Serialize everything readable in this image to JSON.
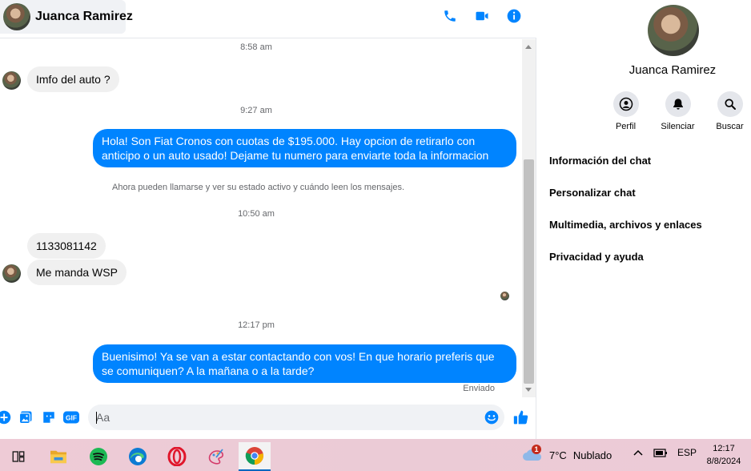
{
  "header": {
    "contact_name": "Juanca Ramirez",
    "actions": [
      {
        "icon": "phone-icon"
      },
      {
        "icon": "video-icon"
      },
      {
        "icon": "info-icon"
      }
    ]
  },
  "messages": {
    "timestamps": [
      "8:58 am",
      "9:27 am",
      "10:50 am",
      "12:17 pm"
    ],
    "incoming_1": "Imfo del auto ?",
    "outgoing_1": "Hola! Son Fiat Cronos con cuotas de $195.000. Hay opcion de retirarlo con anticipo o un auto usado! Dejame tu numero para enviarte toda la informacion",
    "system_notice": "Ahora pueden llamarse y ver su estado activo y cuándo leen los mensajes.",
    "incoming_2": "1133081142",
    "incoming_3": "Me manda WSP",
    "outgoing_2": "Buenisimo! Ya se van a estar contactando con vos! En que horario preferis que se comuniquen? A la mañana o a la tarde?",
    "status": "Enviado"
  },
  "composer": {
    "placeholder": "Aa",
    "icons": [
      "plus-icon",
      "photo-icon",
      "sticker-icon",
      "gif-icon",
      "emoji-icon",
      "like-icon"
    ],
    "gif_label": "GIF"
  },
  "info_panel": {
    "name": "Juanca Ramirez",
    "actions": [
      {
        "label": "Perfil",
        "icon": "profile-icon"
      },
      {
        "label": "Silenciar",
        "icon": "bell-icon"
      },
      {
        "label": "Buscar",
        "icon": "search-icon"
      }
    ],
    "menu": [
      "Información del chat",
      "Personalizar chat",
      "Multimedia, archivos y enlaces",
      "Privacidad y ayuda"
    ]
  },
  "taskbar": {
    "apps": [
      "task-view-icon",
      "file-explorer-icon",
      "spotify-icon",
      "edge-icon",
      "opera-icon",
      "paint-icon",
      "chrome-icon"
    ],
    "weather": {
      "temp": "7°C",
      "condition": "Nublado",
      "badge": "1"
    },
    "language": "ESP",
    "time": "12:17",
    "date": "8/8/2024"
  },
  "colors": {
    "messenger_blue": "#0084ff",
    "incoming_bubble": "#f0f0f0",
    "taskbar": "#ebcbd6"
  }
}
